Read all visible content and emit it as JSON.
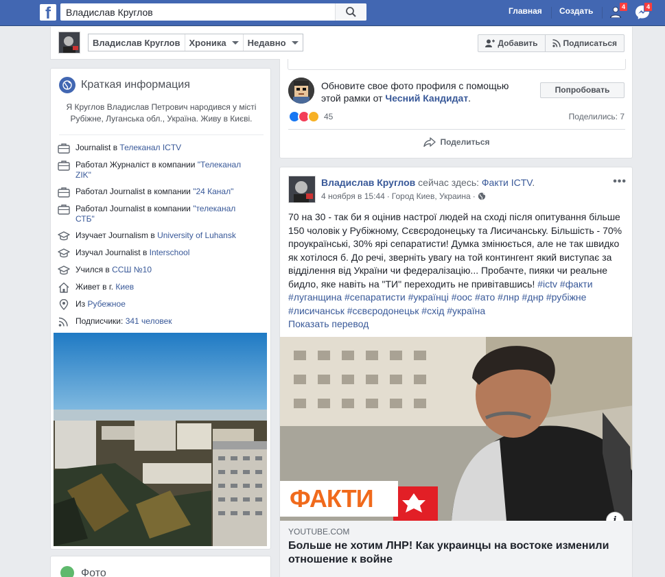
{
  "topbar": {
    "logo": "f",
    "search_value": "Владислав Круглов",
    "home": "Главная",
    "create": "Создать",
    "friends_badge": "4",
    "messages_badge": "4"
  },
  "timeline_header": {
    "name": "Владислав Круглов",
    "chronicle": "Хроника",
    "recent": "Недавно",
    "add_button": "Добавить",
    "subscribe_button": "Подписаться"
  },
  "intro": {
    "title": "Краткая информация",
    "bio": "Я Круглов Владислав Петрович народився у місті Рубіжне, Луганська обл., Україна. Живу в Києві.",
    "items": [
      {
        "icon": "briefcase-icon",
        "pre": "Journalist в ",
        "link": "Телеканал ICTV",
        "post": ""
      },
      {
        "icon": "briefcase-icon",
        "pre": "Работал Журналіст в компании ",
        "link": "\"Телеканал ZIK\"",
        "post": ""
      },
      {
        "icon": "briefcase-icon",
        "pre": "Работал Journalist в компании ",
        "link": "\"24 Канал\"",
        "post": ""
      },
      {
        "icon": "briefcase-icon",
        "pre": "Работал Journalist в компании ",
        "link": "\"телеканал СТБ\"",
        "post": ""
      },
      {
        "icon": "graduation-cap-icon",
        "pre": "Изучает Journalism в ",
        "link": "University of Luhansk",
        "post": ""
      },
      {
        "icon": "graduation-cap-icon",
        "pre": "Изучал Journalist в ",
        "link": "Interschool",
        "post": ""
      },
      {
        "icon": "graduation-cap-icon",
        "pre": "Учился в ",
        "link": "ССШ №10",
        "post": ""
      },
      {
        "icon": "house-icon",
        "pre": "Живет в г. ",
        "link": "Киев",
        "post": ""
      },
      {
        "icon": "location-pin-icon",
        "pre": "Из ",
        "link": "Рубежное",
        "post": ""
      },
      {
        "icon": "rss-icon",
        "pre": "Подписчики: ",
        "link": "341 человек",
        "post": ""
      }
    ]
  },
  "photos": {
    "title": "Фото"
  },
  "shared_post": {
    "frame_text_pre": "Обновите свое фото профиля с помощью этой рамки от ",
    "frame_link": "Чесний Кандидат",
    "frame_text_post": ".",
    "try_button": "Попробовать",
    "reactions_count": "45",
    "shares": "Поделились: 7",
    "share_action": "Поделиться"
  },
  "post": {
    "author": "Владислав Круглов",
    "location_pre": " сейчас здесь: ",
    "location": "Факти ICTV",
    "location_post": ".",
    "date": "4 ноября в 15:44",
    "place": "Город Киев, Украина",
    "text": "70 на 30 - так би я оцінив настрої людей на сході після опитування більше 150 чоловік у Рубіжному, Сєвєродонецьку та Лисичанську. Більшість - 70% проукраїнські, 30% ярі сепаратисти! Думка змінюється, але не так швидко як хотілося б. До речі, зверніть увагу на той контингент який виступає за відділення від України чи федералізацію... Пробачте, пияки чи реальне бидло, яке навіть на \"ТИ\" переходить не привітавшись!",
    "hashtags": "#ictv #факти #луганщина #сепаратисти #українці #оос #ато #лнр #днр #рубіжне #лисичанськ #сєвєродонецьк #схід #україна",
    "translate": "Показать перевод",
    "image_brand": "ФАКТИ",
    "link_source": "YOUTUBE.COM",
    "link_title": "Больше не хотим ЛНР! Как украинцы на востоке изменили отношение к войне"
  }
}
